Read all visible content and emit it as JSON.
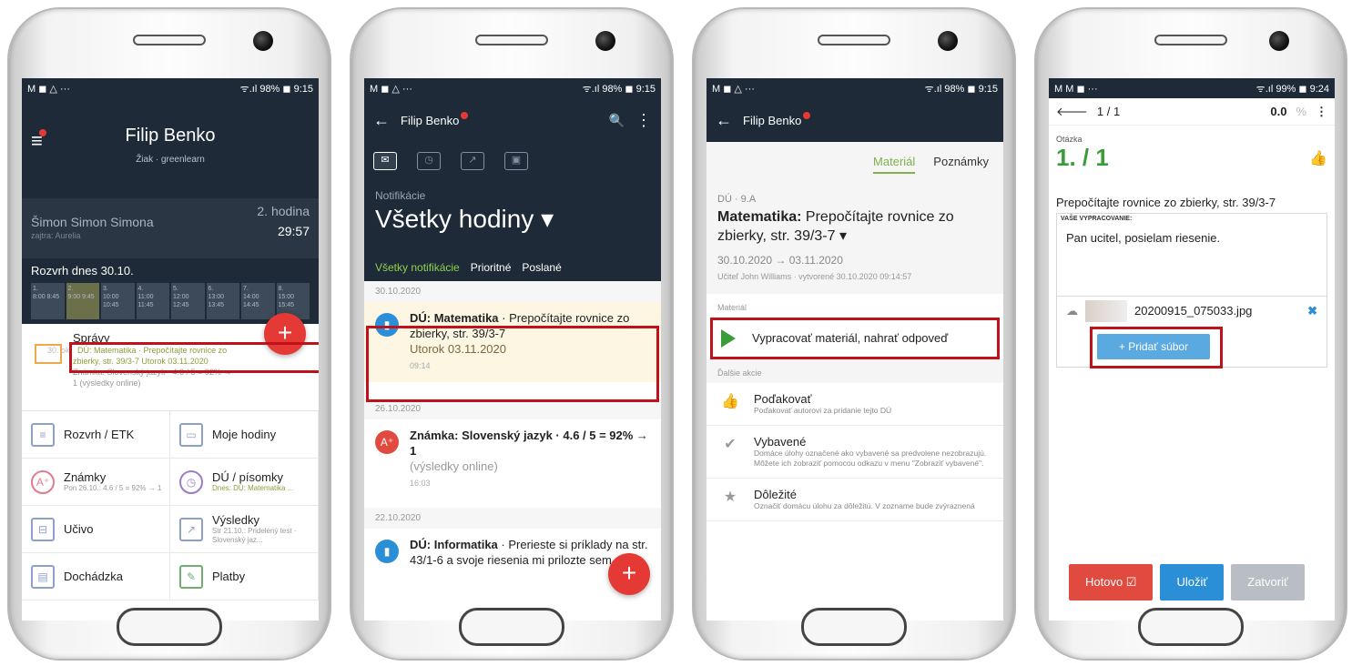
{
  "phone1": {
    "status": {
      "left": "M ◼ △ ···",
      "right": "ᯤ.ıl 98% ◼ 9:15"
    },
    "title": "Filip Benko",
    "subtitle": "Žiak · greenlearn",
    "lesson": {
      "teacher": "Šimon Simon Simona",
      "next": "zajtra: Aurelia",
      "hour": "2. hodina",
      "time": "29:57"
    },
    "schedule": {
      "title": "Rozvrh dnes 30.10.",
      "cells": [
        {
          "num": "1.",
          "time": "8:00 8:45"
        },
        {
          "num": "2.",
          "time": "9:00 9:45"
        },
        {
          "num": "3.",
          "time": "10:00 10:45"
        },
        {
          "num": "4.",
          "time": "11:00 11:45"
        },
        {
          "num": "5.",
          "time": "12:00 12:45"
        },
        {
          "num": "6.",
          "time": "13:00 13:45"
        },
        {
          "num": "7.",
          "time": "14:00 14:45"
        },
        {
          "num": "8.",
          "time": "15:00 15:45"
        }
      ]
    },
    "fab": "+",
    "messages": {
      "title": "Správy",
      "count": "30. okt",
      "line1": "DÚ: Matematika · Prepočítajte rovnice zo",
      "line2": "zbierky, str. 39/3-7 Utorok 03.11.2020",
      "line3": "Známka: Slovenský jazyk · 4.6 / 5 = 92% →",
      "line4": "1 (výsledky online)"
    },
    "tiles": [
      {
        "label": "Rozvrh / ETK",
        "sub": "",
        "icon": "≡"
      },
      {
        "label": "Moje hodiny",
        "sub": "",
        "icon": "▭"
      },
      {
        "label": "Známky",
        "sub": "Pon 26.10.: 4.6 / 5 = 92% → 1",
        "icon": "A⁺"
      },
      {
        "label": "DÚ / písomky",
        "sub": "Dnes: DÚ: Matematika ...",
        "icon": "◷"
      },
      {
        "label": "Učivo",
        "sub": "",
        "icon": "⊟"
      },
      {
        "label": "Výsledky",
        "sub": "Str 21.10.: Pridelený test · Slovenský jaz...",
        "icon": "↗"
      },
      {
        "label": "Dochádzka",
        "sub": "",
        "icon": "▤"
      },
      {
        "label": "Platby",
        "sub": "",
        "icon": "✎"
      }
    ]
  },
  "phone2": {
    "status": {
      "left": "M ◼ △ ···",
      "right": "ᯤ.ıl 98% ◼ 9:15"
    },
    "header": {
      "back": "←",
      "name": "Filip Benko",
      "search": "🔍",
      "more": "⋮"
    },
    "icons": [
      "✉",
      "◷",
      "↗",
      "▣"
    ],
    "notif_label": "Notifikácie",
    "heading": "Všetky hodiny ▾",
    "tabs": [
      "Všetky notifikácie",
      "Prioritné",
      "Poslané"
    ],
    "groups": [
      {
        "date": "30.10.2020",
        "items": [
          {
            "icon": "▮",
            "type": "blue",
            "bold": "DÚ: Matematika",
            "text": " · Prepočítajte rovnice zo zbierky, str. 39/3-7",
            "grey": "Utorok 03.11.2020",
            "time": "09:14"
          }
        ]
      },
      {
        "date": "26.10.2020",
        "items": [
          {
            "icon": "A⁺",
            "type": "red",
            "bold": "Známka: Slovenský jazyk · 4.6 / 5 = 92% → 1",
            "text": "",
            "grey": "(výsledky online)",
            "time": "16:03"
          }
        ]
      },
      {
        "date": "22.10.2020",
        "items": [
          {
            "icon": "▮",
            "type": "blue",
            "bold": "DÚ: Informatika",
            "text": " · Prerieste si príklady na str. 43/1-6 a svoje riesenia mi prilozte sem.",
            "grey": "",
            "time": ""
          }
        ]
      }
    ],
    "fab": "+"
  },
  "phone3": {
    "status": {
      "left": "M ◼ △ ···",
      "right": "ᯤ.ıl 98% ◼ 9:15"
    },
    "header": {
      "back": "←",
      "name": "Filip Benko"
    },
    "tabs": [
      "Materiál",
      "Poznámky"
    ],
    "tag": "DÚ · 9.A",
    "title_bold": "Matematika:",
    "title_rest": " Prepočítajte rovnice zo zbierky, str. 39/3-7 ▾",
    "dates": "30.10.2020 → 03.11.2020",
    "teacher": "Učiteľ John Williams · vytvorené 30.10.2020 09:14:57",
    "section_material": "Materiál",
    "action": "Vypracovať materiál, nahrať odpoveď",
    "section_more": "Ďalšie akcie",
    "rows": [
      {
        "icon": "👍",
        "title": "Poďakovať",
        "sub": "Poďakovať autorovi za pridanie tejto DÚ"
      },
      {
        "icon": "✔",
        "title": "Vybavené",
        "sub": "Domáce úlohy označené ako vybavené sa predvolene nezobrazujú. Môžete ich zobraziť pomocou odkazu v menu \"Zobraziť vybavené\"."
      },
      {
        "icon": "★",
        "title": "Dôležité",
        "sub": "Označiť domácu úlohu za dôležitú. V zozname bude zvýraznená"
      }
    ]
  },
  "phone4": {
    "status": {
      "left": "M M ◼ ···",
      "right": "ᯤ.ıl 99% ◼ 9:24"
    },
    "header": {
      "back": "🡐",
      "count": "1 / 1",
      "score": "0.0",
      "pct": "%",
      "more": "⋮"
    },
    "otazka": "Otázka",
    "number": "1. / 1",
    "question": "Prepočítajte rovnice zo zbierky, str. 39/3-7",
    "answer_label": "VAŠE VYPRACOVANIE:",
    "answer_text": "Pan ucitel, posielam riesenie.",
    "file": "20200915_075033.jpg",
    "add_file": "+ Pridať súbor",
    "buttons": {
      "done": "Hotovo ☑",
      "save": "Uložiť",
      "close": "Zatvoriť"
    }
  }
}
